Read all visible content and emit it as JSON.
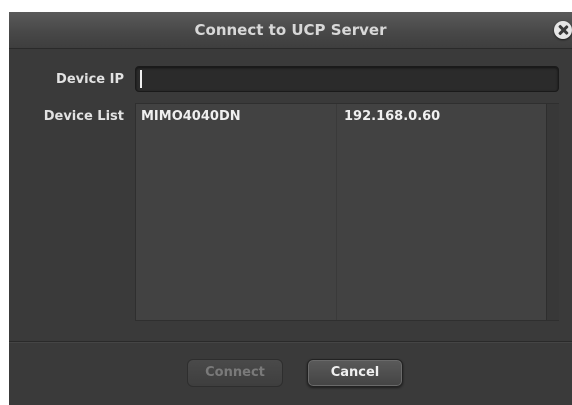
{
  "dialog": {
    "title": "Connect to UCP Server"
  },
  "form": {
    "device_ip_label": "Device IP",
    "device_ip_value": "",
    "device_list_label": "Device List"
  },
  "device_list": {
    "rows": [
      {
        "name": "MIMO4040DN",
        "ip": "192.168.0.60"
      }
    ]
  },
  "buttons": {
    "connect_label": "Connect",
    "cancel_label": "Cancel"
  },
  "icons": {
    "close": "close-icon"
  },
  "colors": {
    "dialog_bg": "#3a3a3a",
    "titlebar": "#4a4a4a",
    "list_bg": "#424242",
    "text": "#e2e2e2",
    "disabled_text": "#7a7a7a"
  }
}
